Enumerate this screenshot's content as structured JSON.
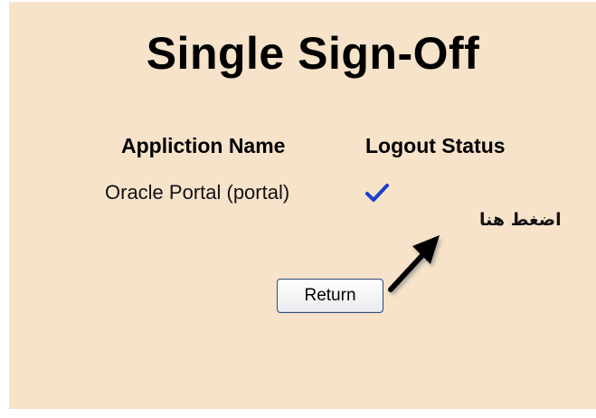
{
  "page": {
    "title": "Single Sign-Off"
  },
  "table": {
    "headers": [
      "Appliction Name",
      "Logout Status"
    ],
    "rows": [
      {
        "application": "Oracle Portal (portal)",
        "status_icon": "checkmark-icon"
      }
    ]
  },
  "annotation": {
    "text": "اضغط هنا",
    "arrow_icon": "arrow-pointer-icon"
  },
  "actions": {
    "return_label": "Return"
  },
  "colors": {
    "background": "#f7e3ca",
    "check": "#1a3fd1",
    "button_border": "#33497a"
  }
}
